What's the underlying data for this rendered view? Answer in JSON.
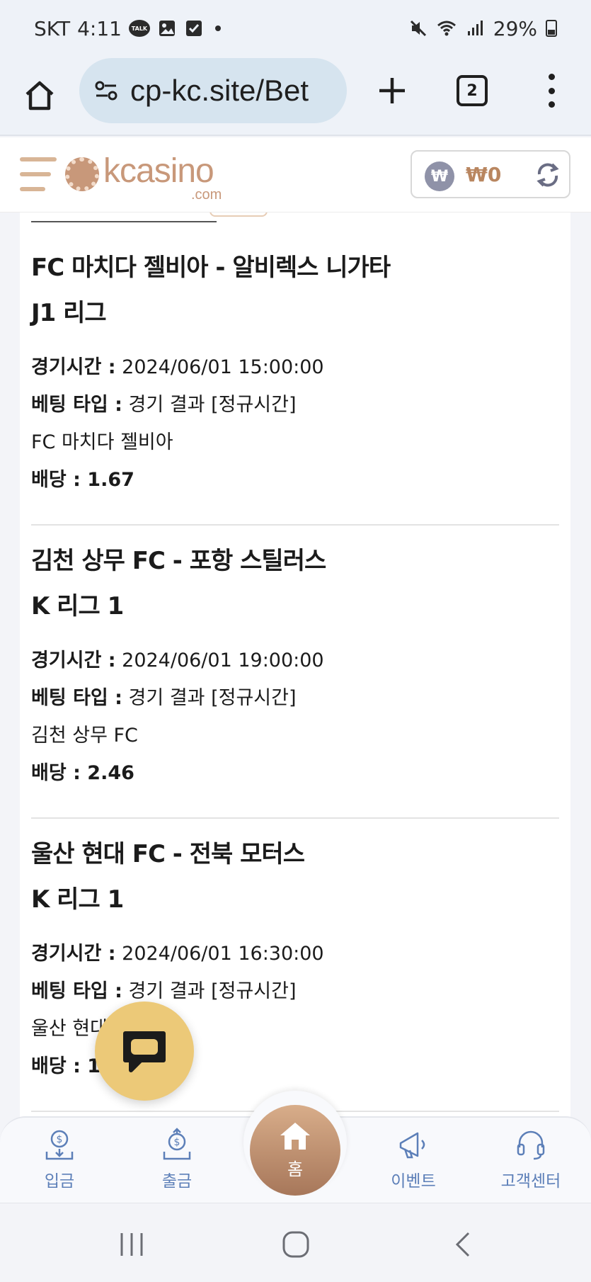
{
  "status_bar": {
    "carrier": "SKT",
    "time": "4:11",
    "talk_badge": "TALK",
    "battery": "29%"
  },
  "browser": {
    "url": "cp-kc.site/Bet",
    "tab_count": "2"
  },
  "header": {
    "logo_main": "kcasino",
    "logo_sub": ".com",
    "currency_symbol": "₩",
    "balance": "₩0",
    "brand_color": "#c8987a"
  },
  "bets": [
    {
      "match": "FC 마치다 젤비아 - 알비렉스 니가타",
      "league": "J1 리그",
      "time_label": "경기시간 :",
      "time_value": " 2024/06/01 15:00:00",
      "type_label": "베팅 타입 :",
      "type_value": " 경기 결과 [정규시간]",
      "pick": "FC 마치다 젤비아",
      "odds": "배당 : 1.67"
    },
    {
      "match": "김천 상무 FC - 포항 스틸러스",
      "league": "K 리그 1",
      "time_label": "경기시간 :",
      "time_value": " 2024/06/01 19:00:00",
      "type_label": "베팅 타입 :",
      "type_value": " 경기 결과 [정규시간]",
      "pick": "김천 상무 FC",
      "odds": "배당 : 2.46"
    },
    {
      "match": "울산 현대 FC - 전북 모터스",
      "league": "K 리그 1",
      "time_label": "경기시간 :",
      "time_value": " 2024/06/01 16:30:00",
      "type_label": "베팅 타입 :",
      "type_value": " 경기 결과 [정규시간]",
      "pick": "울산 현대",
      "odds": "배당 : 1."
    }
  ],
  "bottom_nav": {
    "deposit": "입금",
    "withdraw": "출금",
    "home": "홈",
    "event": "이벤트",
    "support": "고객센터",
    "icon_color": "#5c7fb8"
  }
}
